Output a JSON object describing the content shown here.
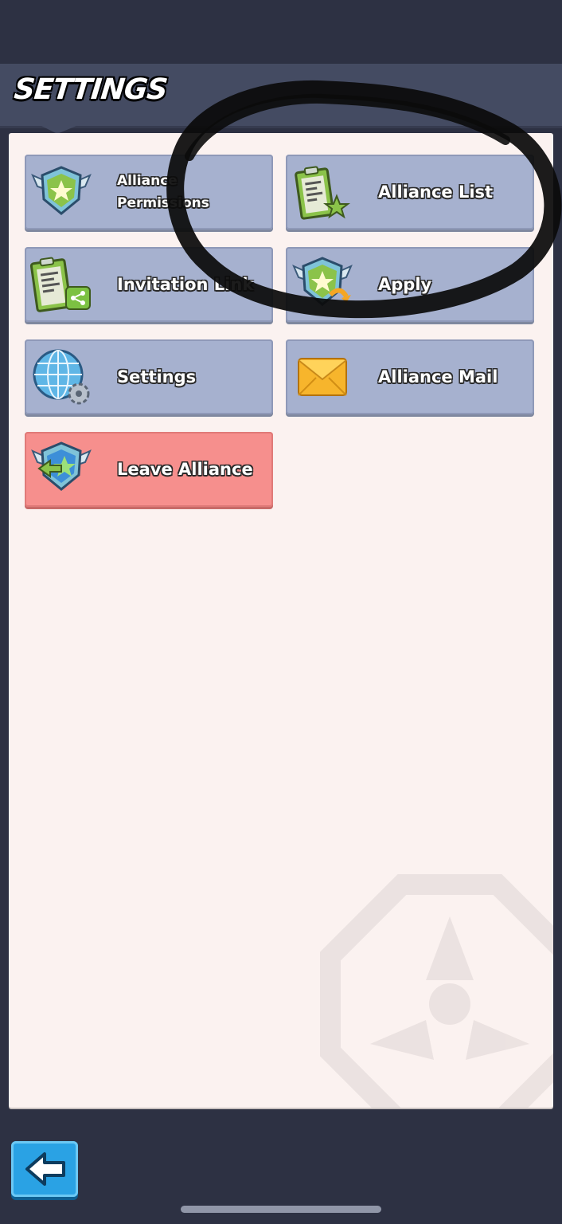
{
  "header": {
    "title": "SETTINGS"
  },
  "buttons": {
    "alliance_permissions": {
      "label": "Alliance\nPermissions",
      "icon": "alliance-badge-icon"
    },
    "alliance_list": {
      "label": "Alliance List",
      "icon": "clipboard-star-icon"
    },
    "invitation_link": {
      "label": "Invitation Link",
      "icon": "clipboard-share-icon"
    },
    "apply": {
      "label": "Apply",
      "icon": "alliance-badge-arrow-icon"
    },
    "settings": {
      "label": "Settings",
      "icon": "globe-gear-icon"
    },
    "alliance_mail": {
      "label": "Alliance Mail",
      "icon": "envelope-icon"
    },
    "leave_alliance": {
      "label": "Leave Alliance",
      "icon": "alliance-badge-exit-icon"
    }
  },
  "footer": {
    "back_icon": "back-arrow-icon"
  },
  "colors": {
    "button_blue": "#a6b1cf",
    "button_red": "#f68f8d",
    "panel": "#fbf2f0",
    "background": "#2d3143",
    "back_button": "#2aa2e4"
  }
}
